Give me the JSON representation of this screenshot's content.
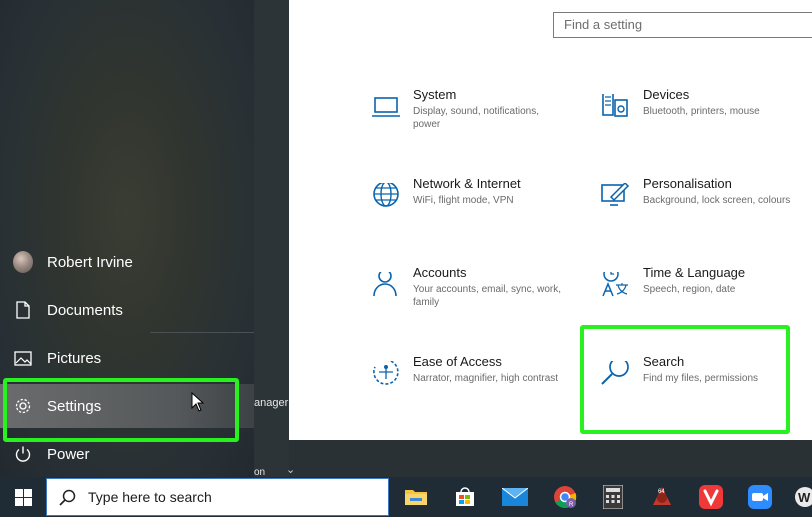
{
  "start_menu": {
    "user_name": "Robert Irvine",
    "items": [
      {
        "label": "Documents",
        "icon": "document-icon"
      },
      {
        "label": "Pictures",
        "icon": "pictures-icon"
      },
      {
        "label": "Settings",
        "icon": "gear-icon"
      },
      {
        "label": "Power",
        "icon": "power-icon"
      }
    ],
    "background_fragments": [
      "anager",
      "on"
    ]
  },
  "settings": {
    "search_placeholder": "Find a setting",
    "tiles": [
      {
        "title": "System",
        "desc": "Display, sound, notifications, power",
        "icon": "laptop-icon"
      },
      {
        "title": "Devices",
        "desc": "Bluetooth, printers, mouse",
        "icon": "devices-icon"
      },
      {
        "title": "Network & Internet",
        "desc": "WiFi, flight mode, VPN",
        "icon": "globe-icon"
      },
      {
        "title": "Personalisation",
        "desc": "Background, lock screen, colours",
        "icon": "paint-icon"
      },
      {
        "title": "Accounts",
        "desc": "Your accounts, email, sync, work, family",
        "icon": "person-icon"
      },
      {
        "title": "Time & Language",
        "desc": "Speech, region, date",
        "icon": "time-language-icon"
      },
      {
        "title": "Ease of Access",
        "desc": "Narrator, magnifier, high contrast",
        "icon": "ease-of-access-icon"
      },
      {
        "title": "Search",
        "desc": "Find my files, permissions",
        "icon": "search-icon"
      }
    ]
  },
  "taskbar": {
    "search_placeholder": "Type here to search",
    "apps": [
      "file-explorer-icon",
      "store-icon",
      "mail-icon",
      "chrome-icon",
      "calculator-icon",
      "game-icon",
      "vivaldi-icon",
      "zoom-icon",
      "app-icon"
    ]
  },
  "colors": {
    "highlight": "#29f01f",
    "accent": "#0a64ad"
  }
}
